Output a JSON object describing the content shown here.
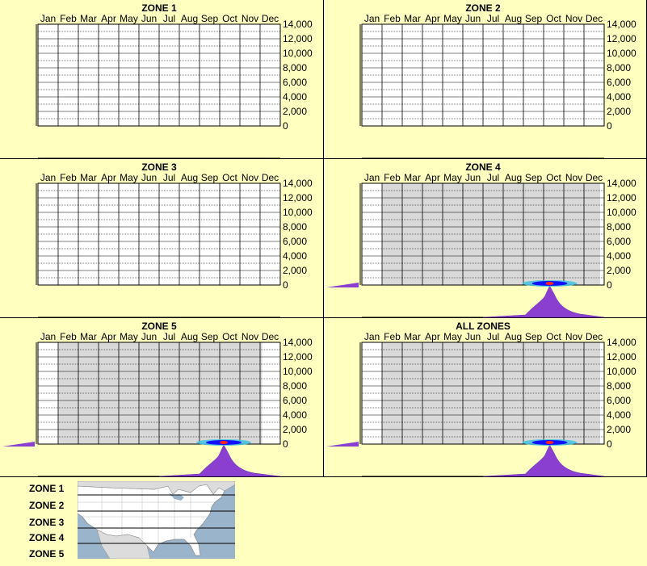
{
  "colors": {
    "background": "#ffffc0",
    "plot_bg": "#ffffff",
    "plot_active_bg": "#d9d9d9",
    "density": "#8a3fd1",
    "hotspot_core": "#ff2020",
    "hotspot_mid": "#1010ff",
    "hotspot_outer": "#40c0e0",
    "grid": "#000000"
  },
  "months": [
    "Jan",
    "Feb",
    "Mar",
    "Apr",
    "May",
    "Jun",
    "Jul",
    "Aug",
    "Sep",
    "Oct",
    "Nov",
    "Dec"
  ],
  "y_ticks": [
    "14,000",
    "12,000",
    "10,000",
    "8,000",
    "6,000",
    "4,000",
    "2,000",
    "0"
  ],
  "charts": [
    {
      "title": "ZONE 1",
      "active": false
    },
    {
      "title": "ZONE 2",
      "active": false
    },
    {
      "title": "ZONE 3",
      "active": false
    },
    {
      "title": "ZONE 4",
      "active": true,
      "active_from_month": 1,
      "active_to_month": 11.8,
      "density_peak_month": 9.3,
      "hotspot_month": 9.3,
      "hotspot_elevation": 0
    },
    {
      "title": "ZONE 5",
      "active": true,
      "active_from_month": 1,
      "active_to_month": 11.1,
      "density_peak_month": 9.2,
      "hotspot_month": 9.2,
      "hotspot_elevation": 0
    },
    {
      "title": "ALL ZONES",
      "active": true,
      "active_from_month": 1,
      "active_to_month": 11.8,
      "density_peak_month": 9.3,
      "hotspot_month": 9.3,
      "hotspot_elevation": 0
    }
  ],
  "chart_data": [
    {
      "type": "heatmap",
      "title": "ZONE 1",
      "x_categories": [
        "Jan",
        "Feb",
        "Mar",
        "Apr",
        "May",
        "Jun",
        "Jul",
        "Aug",
        "Sep",
        "Oct",
        "Nov",
        "Dec"
      ],
      "ylim": [
        0,
        14000
      ],
      "y_ticks": [
        0,
        2000,
        4000,
        6000,
        8000,
        10000,
        12000,
        14000
      ],
      "values": []
    },
    {
      "type": "heatmap",
      "title": "ZONE 2",
      "x_categories": [
        "Jan",
        "Feb",
        "Mar",
        "Apr",
        "May",
        "Jun",
        "Jul",
        "Aug",
        "Sep",
        "Oct",
        "Nov",
        "Dec"
      ],
      "ylim": [
        0,
        14000
      ],
      "y_ticks": [
        0,
        2000,
        4000,
        6000,
        8000,
        10000,
        12000,
        14000
      ],
      "values": []
    },
    {
      "type": "heatmap",
      "title": "ZONE 3",
      "x_categories": [
        "Jan",
        "Feb",
        "Mar",
        "Apr",
        "May",
        "Jun",
        "Jul",
        "Aug",
        "Sep",
        "Oct",
        "Nov",
        "Dec"
      ],
      "ylim": [
        0,
        14000
      ],
      "y_ticks": [
        0,
        2000,
        4000,
        6000,
        8000,
        10000,
        12000,
        14000
      ],
      "values": []
    },
    {
      "type": "heatmap",
      "title": "ZONE 4",
      "x_categories": [
        "Jan",
        "Feb",
        "Mar",
        "Apr",
        "May",
        "Jun",
        "Jul",
        "Aug",
        "Sep",
        "Oct",
        "Nov",
        "Dec"
      ],
      "ylim": [
        0,
        14000
      ],
      "y_ticks": [
        0,
        2000,
        4000,
        6000,
        8000,
        10000,
        12000,
        14000
      ],
      "values": [
        {
          "month": "Oct",
          "elevation": 0,
          "intensity": "high"
        }
      ]
    },
    {
      "type": "heatmap",
      "title": "ZONE 5",
      "x_categories": [
        "Jan",
        "Feb",
        "Mar",
        "Apr",
        "May",
        "Jun",
        "Jul",
        "Aug",
        "Sep",
        "Oct",
        "Nov",
        "Dec"
      ],
      "ylim": [
        0,
        14000
      ],
      "y_ticks": [
        0,
        2000,
        4000,
        6000,
        8000,
        10000,
        12000,
        14000
      ],
      "values": [
        {
          "month": "Oct",
          "elevation": 0,
          "intensity": "high"
        }
      ]
    },
    {
      "type": "heatmap",
      "title": "ALL ZONES",
      "x_categories": [
        "Jan",
        "Feb",
        "Mar",
        "Apr",
        "May",
        "Jun",
        "Jul",
        "Aug",
        "Sep",
        "Oct",
        "Nov",
        "Dec"
      ],
      "ylim": [
        0,
        14000
      ],
      "y_ticks": [
        0,
        2000,
        4000,
        6000,
        8000,
        10000,
        12000,
        14000
      ],
      "values": [
        {
          "month": "Oct",
          "elevation": 0,
          "intensity": "high"
        }
      ]
    }
  ],
  "legend": {
    "zones": [
      "ZONE 1",
      "ZONE 2",
      "ZONE 3",
      "ZONE 4",
      "ZONE 5"
    ]
  }
}
